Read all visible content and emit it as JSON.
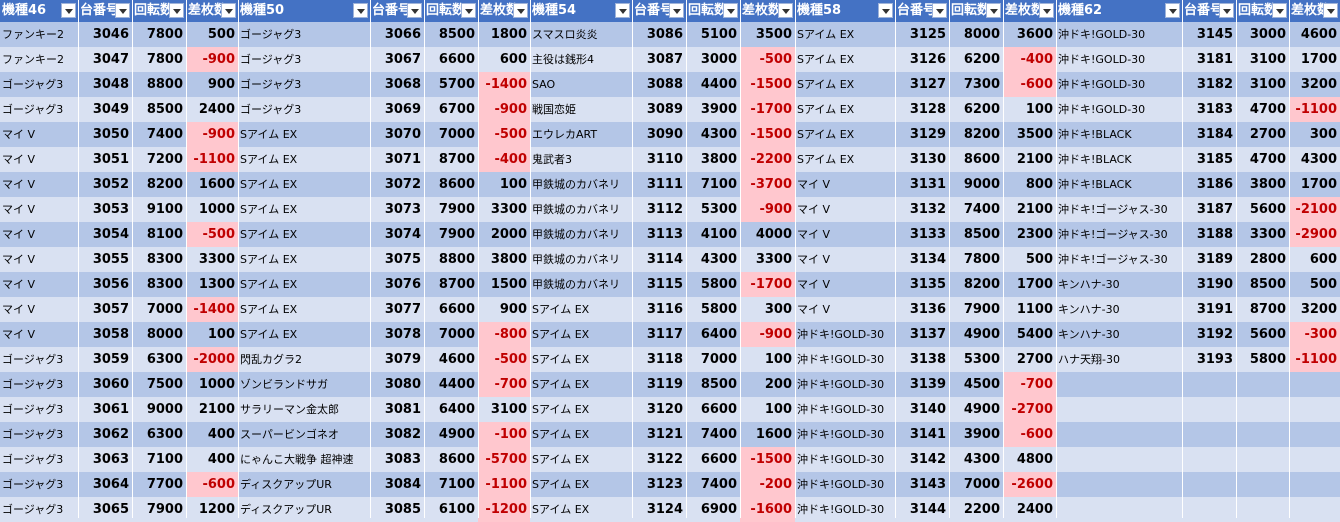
{
  "headers": [
    "機種46",
    "台番号",
    "回転数",
    "差枚数",
    "機種50",
    "台番号",
    "回転数",
    "差枚数",
    "機種54",
    "台番号",
    "回転数",
    "差枚数",
    "機種58",
    "台番号",
    "回転数",
    "差枚数",
    "機種62",
    "台番号",
    "回転数",
    "差枚数"
  ],
  "rows": [
    [
      "ファンキー2",
      "3046",
      "7800",
      "500",
      "ゴージャグ3",
      "3066",
      "8500",
      "1800",
      "スマスロ炎炎",
      "3086",
      "5100",
      "3500",
      "Sアイム EX",
      "3125",
      "8000",
      "3600",
      "沖ドキ!GOLD-30",
      "3145",
      "3000",
      "4600"
    ],
    [
      "ファンキー2",
      "3047",
      "7800",
      "-900",
      "ゴージャグ3",
      "3067",
      "6600",
      "600",
      "主役は銭形4",
      "3087",
      "3000",
      "-500",
      "Sアイム EX",
      "3126",
      "6200",
      "-400",
      "沖ドキ!GOLD-30",
      "3181",
      "3100",
      "1700"
    ],
    [
      "ゴージャグ3",
      "3048",
      "8800",
      "900",
      "ゴージャグ3",
      "3068",
      "5700",
      "-1400",
      "SAO",
      "3088",
      "4400",
      "-1500",
      "Sアイム EX",
      "3127",
      "7300",
      "-600",
      "沖ドキ!GOLD-30",
      "3182",
      "3100",
      "3200"
    ],
    [
      "ゴージャグ3",
      "3049",
      "8500",
      "2400",
      "ゴージャグ3",
      "3069",
      "6700",
      "-900",
      "戦国恋姫",
      "3089",
      "3900",
      "-1700",
      "Sアイム EX",
      "3128",
      "6200",
      "100",
      "沖ドキ!GOLD-30",
      "3183",
      "4700",
      "-1100"
    ],
    [
      "マイ V",
      "3050",
      "7400",
      "-900",
      "Sアイム EX",
      "3070",
      "7000",
      "-500",
      "エウレカART",
      "3090",
      "4300",
      "-1500",
      "Sアイム EX",
      "3129",
      "8200",
      "3500",
      "沖ドキ!BLACK",
      "3184",
      "2700",
      "300"
    ],
    [
      "マイ V",
      "3051",
      "7200",
      "-1100",
      "Sアイム EX",
      "3071",
      "8700",
      "-400",
      "鬼武者3",
      "3110",
      "3800",
      "-2200",
      "Sアイム EX",
      "3130",
      "8600",
      "2100",
      "沖ドキ!BLACK",
      "3185",
      "4700",
      "4300"
    ],
    [
      "マイ V",
      "3052",
      "8200",
      "1600",
      "Sアイム EX",
      "3072",
      "8600",
      "100",
      "甲鉄城のカバネリ",
      "3111",
      "7100",
      "-3700",
      "マイ V",
      "3131",
      "9000",
      "800",
      "沖ドキ!BLACK",
      "3186",
      "3800",
      "1700"
    ],
    [
      "マイ V",
      "3053",
      "9100",
      "1000",
      "Sアイム EX",
      "3073",
      "7900",
      "3300",
      "甲鉄城のカバネリ",
      "3112",
      "5300",
      "-900",
      "マイ V",
      "3132",
      "7400",
      "2100",
      "沖ドキ!ゴージャス-30",
      "3187",
      "5600",
      "-2100"
    ],
    [
      "マイ V",
      "3054",
      "8100",
      "-500",
      "Sアイム EX",
      "3074",
      "7900",
      "2000",
      "甲鉄城のカバネリ",
      "3113",
      "4100",
      "4000",
      "マイ V",
      "3133",
      "8500",
      "2300",
      "沖ドキ!ゴージャス-30",
      "3188",
      "3300",
      "-2900"
    ],
    [
      "マイ V",
      "3055",
      "8300",
      "3300",
      "Sアイム EX",
      "3075",
      "8800",
      "3800",
      "甲鉄城のカバネリ",
      "3114",
      "4300",
      "3300",
      "マイ V",
      "3134",
      "7800",
      "500",
      "沖ドキ!ゴージャス-30",
      "3189",
      "2800",
      "600"
    ],
    [
      "マイ V",
      "3056",
      "8300",
      "1300",
      "Sアイム EX",
      "3076",
      "8700",
      "1500",
      "甲鉄城のカバネリ",
      "3115",
      "5800",
      "-1700",
      "マイ V",
      "3135",
      "8200",
      "1700",
      "キンハナ-30",
      "3190",
      "8500",
      "500"
    ],
    [
      "マイ V",
      "3057",
      "7000",
      "-1400",
      "Sアイム EX",
      "3077",
      "6600",
      "900",
      "Sアイム EX",
      "3116",
      "5800",
      "300",
      "マイ V",
      "3136",
      "7900",
      "1100",
      "キンハナ-30",
      "3191",
      "8700",
      "3200"
    ],
    [
      "マイ V",
      "3058",
      "8000",
      "100",
      "Sアイム EX",
      "3078",
      "7000",
      "-800",
      "Sアイム EX",
      "3117",
      "6400",
      "-900",
      "沖ドキ!GOLD-30",
      "3137",
      "4900",
      "5400",
      "キンハナ-30",
      "3192",
      "5600",
      "-300"
    ],
    [
      "ゴージャグ3",
      "3059",
      "6300",
      "-2000",
      "閃乱カグラ2",
      "3079",
      "4600",
      "-500",
      "Sアイム EX",
      "3118",
      "7000",
      "100",
      "沖ドキ!GOLD-30",
      "3138",
      "5300",
      "2700",
      "ハナ天翔-30",
      "3193",
      "5800",
      "-1100"
    ],
    [
      "ゴージャグ3",
      "3060",
      "7500",
      "1000",
      "ゾンビランドサガ",
      "3080",
      "4400",
      "-700",
      "Sアイム EX",
      "3119",
      "8500",
      "200",
      "沖ドキ!GOLD-30",
      "3139",
      "4500",
      "-700",
      "",
      "",
      "",
      ""
    ],
    [
      "ゴージャグ3",
      "3061",
      "9000",
      "2100",
      "サラリーマン金太郎",
      "3081",
      "6400",
      "3100",
      "Sアイム EX",
      "3120",
      "6600",
      "100",
      "沖ドキ!GOLD-30",
      "3140",
      "4900",
      "-2700",
      "",
      "",
      "",
      ""
    ],
    [
      "ゴージャグ3",
      "3062",
      "6300",
      "400",
      "スーパービンゴネオ",
      "3082",
      "4900",
      "-100",
      "Sアイム EX",
      "3121",
      "7400",
      "1600",
      "沖ドキ!GOLD-30",
      "3141",
      "3900",
      "-600",
      "",
      "",
      "",
      ""
    ],
    [
      "ゴージャグ3",
      "3063",
      "7100",
      "400",
      "にゃんこ大戦争 超神速",
      "3083",
      "8600",
      "-5700",
      "Sアイム EX",
      "3122",
      "6600",
      "-1500",
      "沖ドキ!GOLD-30",
      "3142",
      "4300",
      "4800",
      "",
      "",
      "",
      ""
    ],
    [
      "ゴージャグ3",
      "3064",
      "7700",
      "-600",
      "ディスクアップUR",
      "3084",
      "7100",
      "-1100",
      "Sアイム EX",
      "3123",
      "7400",
      "-200",
      "沖ドキ!GOLD-30",
      "3143",
      "7000",
      "-2600",
      "",
      "",
      "",
      ""
    ],
    [
      "ゴージャグ3",
      "3065",
      "7900",
      "1200",
      "ディスクアップUR",
      "3085",
      "6100",
      "-1200",
      "Sアイム EX",
      "3124",
      "6900",
      "-1600",
      "沖ドキ!GOLD-30",
      "3144",
      "2200",
      "2400",
      "",
      "",
      "",
      ""
    ]
  ]
}
